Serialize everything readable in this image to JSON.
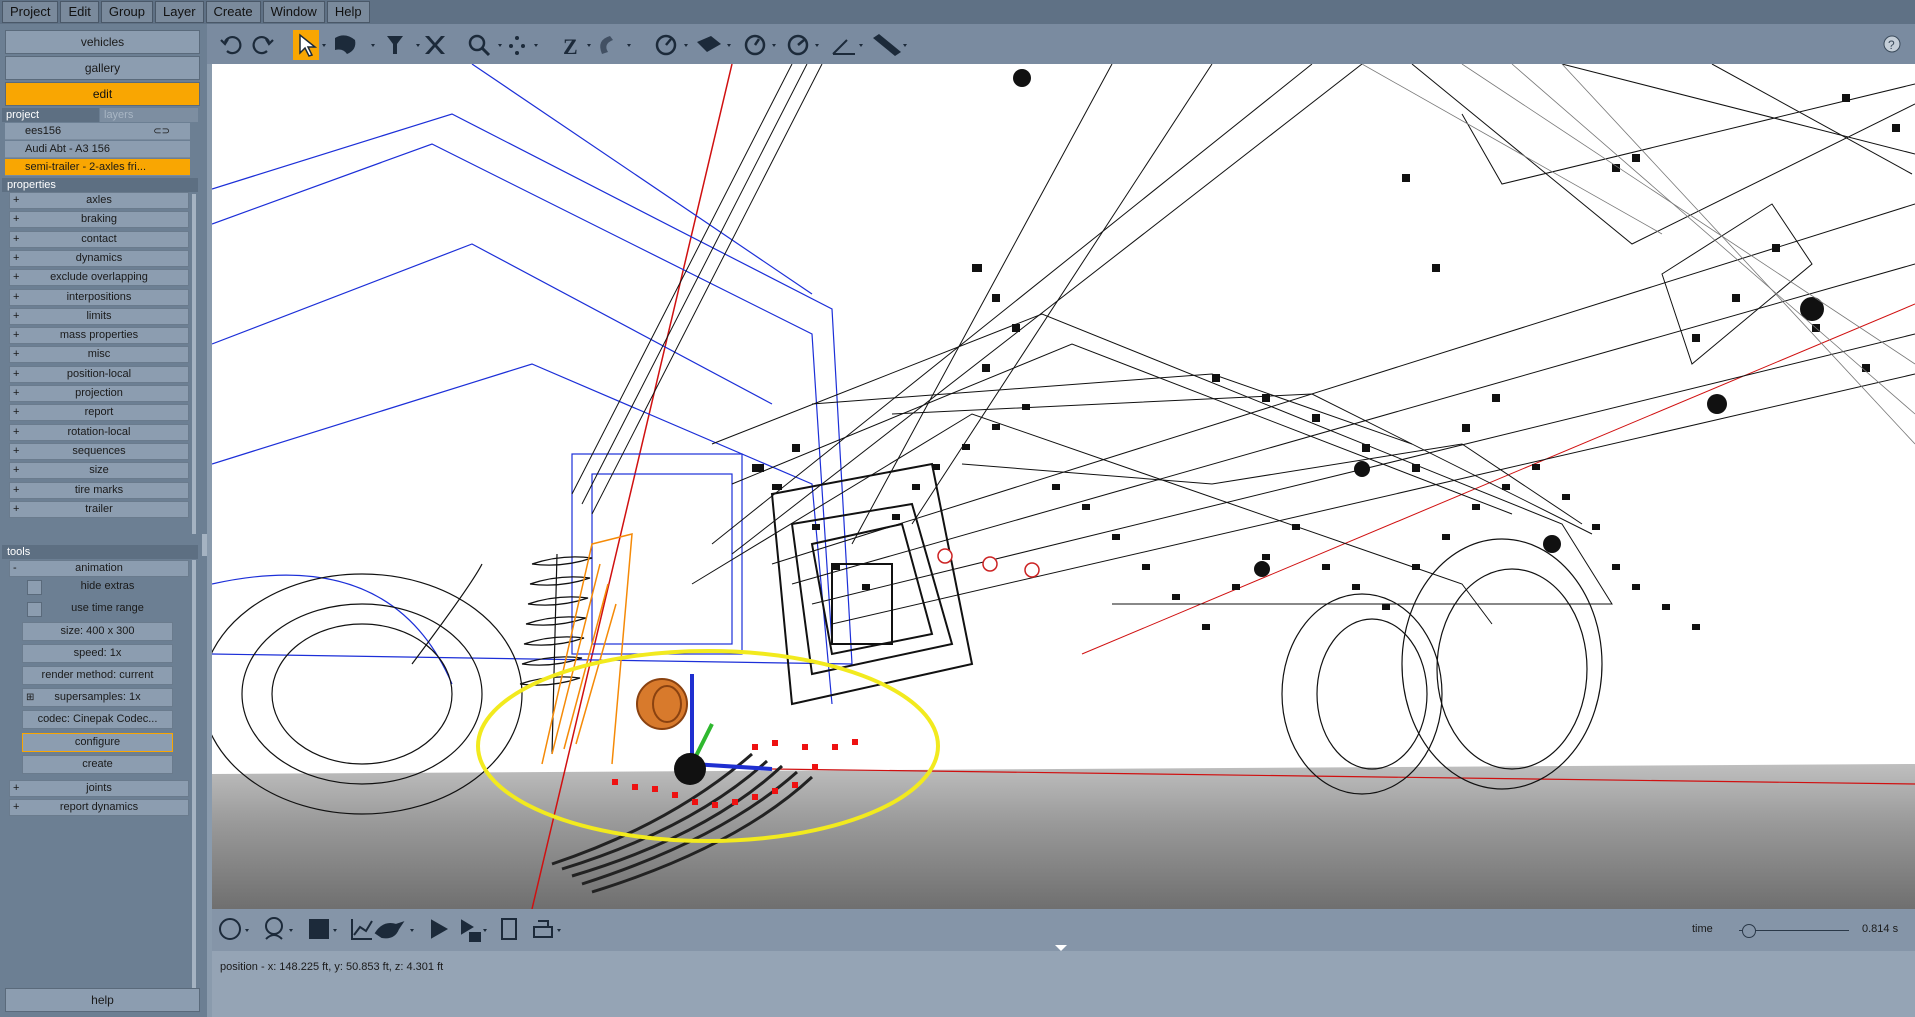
{
  "menubar": {
    "items": [
      "Project",
      "Edit",
      "Group",
      "Layer",
      "Create",
      "Window",
      "Help"
    ]
  },
  "left": {
    "top_buttons": [
      "vehicles",
      "gallery",
      "edit"
    ],
    "active_top": "edit",
    "project_tab": "project",
    "layers_tab": "layers",
    "project_items": [
      "ees156",
      "Audi Abt - A3 156",
      "semi-trailer - 2-axles fri..."
    ],
    "properties_header": "properties",
    "properties": [
      "axles",
      "braking",
      "contact",
      "dynamics",
      "exclude overlapping",
      "interpositions",
      "limits",
      "mass properties",
      "misc",
      "position-local",
      "projection",
      "report",
      "rotation-local",
      "sequences",
      "size",
      "tire marks",
      "trailer"
    ],
    "tools_header": "tools",
    "animation": "animation",
    "hide_extras": "hide extras",
    "use_time_range": "use time range",
    "size": "size: 400 x 300",
    "speed": "speed: 1x",
    "render_method": "render method: current",
    "supersamples": "supersamples: 1x",
    "codec": "codec: Cinepak Codec...",
    "configure": "configure",
    "create": "create",
    "joints": "joints",
    "report_dynamics": "report dynamics",
    "help": "help",
    "plus": "+",
    "minus": "-"
  },
  "toolbar": {
    "icons": [
      "undo-icon",
      "redo-icon",
      "select-arrow-icon",
      "lasso-icon",
      "pin-icon",
      "delete-icon",
      "zoom-icon",
      "move-icon",
      "z-axis-icon",
      "magnet-icon",
      "dial-icon",
      "plane-icon",
      "gauge-icon",
      "speedometer-icon",
      "angle-icon",
      "ruler-icon",
      "help-icon"
    ],
    "z_label": "Z"
  },
  "bottom": {
    "time_label": "time",
    "time_value": "0.814 s",
    "time_fraction": 0.08
  },
  "status": {
    "position": "position - x: 148.225 ft, y: 50.853 ft, z: 4.301 ft"
  },
  "colors": {
    "accent": "#f9a602",
    "panel": "#6c7f93",
    "highlight": "#f2ea1e"
  }
}
